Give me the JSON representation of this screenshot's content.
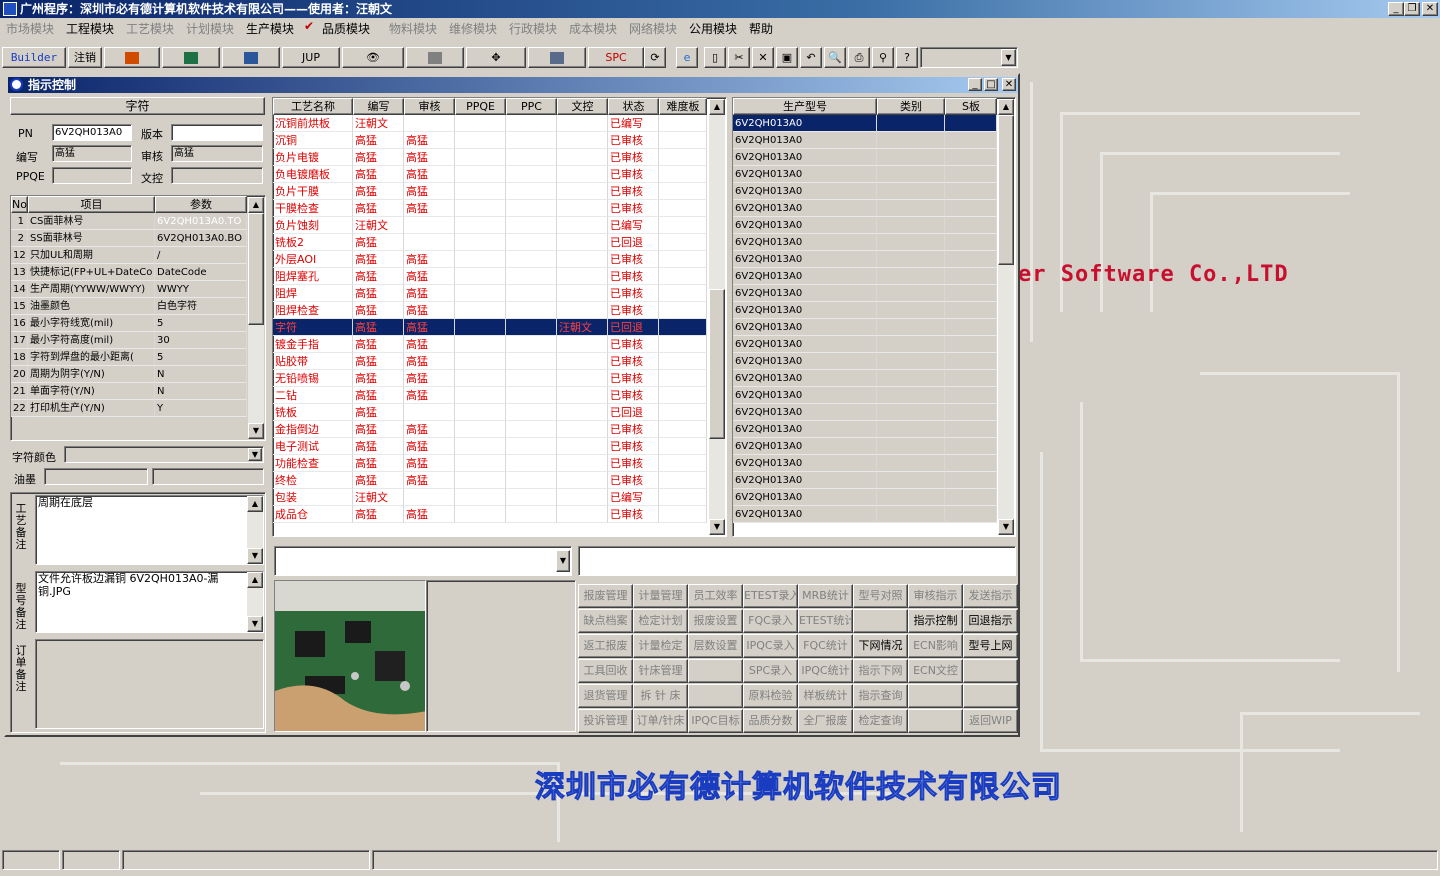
{
  "app_title": "广州程序：深圳市必有德计算机软件技术有限公司——使用者：汪朝文",
  "menu": [
    {
      "label": "市场模块",
      "active": false
    },
    {
      "label": "工程模块",
      "active": true
    },
    {
      "label": "工艺模块",
      "active": false
    },
    {
      "label": "计划模块",
      "active": false
    },
    {
      "label": "生产模块",
      "active": true
    },
    {
      "label": "品质模块",
      "active": true
    },
    {
      "label": "物料模块",
      "active": false
    },
    {
      "label": "维修模块",
      "active": false
    },
    {
      "label": "行政模块",
      "active": false
    },
    {
      "label": "成本模块",
      "active": false
    },
    {
      "label": "网络模块",
      "active": false
    },
    {
      "label": "公用模块",
      "active": true
    },
    {
      "label": "帮助",
      "active": true
    }
  ],
  "toolbar": {
    "builder": "Builder",
    "cancel": "注销",
    "jup": "JUP",
    "spc": "SPC"
  },
  "brand": {
    "english": "er Software Co.,LTD",
    "chinese": "深圳市必有德计算机软件技术有限公司"
  },
  "child_window": {
    "title": "指示控制"
  },
  "form": {
    "section_title": "字符",
    "pn_label": "PN",
    "pn_value": "6V2QH013A0",
    "version_label": "版本",
    "version_value": "",
    "writer_label": "编写",
    "writer_value": "高猛",
    "reviewer_label": "审核",
    "reviewer_value": "高猛",
    "ppqe_label": "PPQE",
    "ppqe_value": "",
    "doc_label": "文控",
    "doc_value": ""
  },
  "params": {
    "headers": [
      "No",
      "项目",
      "参数"
    ],
    "rows": [
      {
        "no": "1",
        "item": "CS面菲林号",
        "value": "6V2QH013A0.TO",
        "selected": true
      },
      {
        "no": "2",
        "item": "SS面菲林号",
        "value": "6V2QH013A0.BO",
        "selected": false
      },
      {
        "no": "12",
        "item": "只加UL和周期",
        "value": "/",
        "selected": false
      },
      {
        "no": "13",
        "item": "快捷标记(FP+UL+DateCo",
        "value": "DateCode",
        "selected": false
      },
      {
        "no": "14",
        "item": "生产周期(YYWW/WWYY)",
        "value": "WWYY",
        "selected": false
      },
      {
        "no": "15",
        "item": "油墨颜色",
        "value": "白色字符",
        "selected": false
      },
      {
        "no": "16",
        "item": "最小字符线宽(mil)",
        "value": "5",
        "selected": false
      },
      {
        "no": "17",
        "item": "最小字符高度(mil)",
        "value": "30",
        "selected": false
      },
      {
        "no": "18",
        "item": "字符到焊盘的最小距离(",
        "value": "5",
        "selected": false
      },
      {
        "no": "20",
        "item": "周期为阴字(Y/N)",
        "value": "N",
        "selected": false
      },
      {
        "no": "21",
        "item": "单面字符(Y/N)",
        "value": "N",
        "selected": false
      },
      {
        "no": "22",
        "item": "打印机生产(Y/N)",
        "value": "Y",
        "selected": false
      }
    ]
  },
  "char_color_label": "字符颜色",
  "ink_label": "油墨",
  "process_note_label": "工艺备注",
  "process_note": "周期在底层",
  "model_note_label": "型号备注",
  "model_note": "文件允许板边漏铜 6V2QH013A0-漏铜.JPG",
  "order_note_label": "订单备注",
  "process_grid": {
    "headers": [
      "工艺名称",
      "编写",
      "审核",
      "PPQE",
      "PPC",
      "文控",
      "状态",
      "难度板"
    ],
    "rows": [
      {
        "name": "沉铜前烘板",
        "writer": "汪朝文",
        "reviewer": "",
        "doc": "",
        "status": "已编写",
        "selected": false
      },
      {
        "name": "沉铜",
        "writer": "高猛",
        "reviewer": "高猛",
        "doc": "",
        "status": "已审核",
        "selected": false
      },
      {
        "name": "负片电镀",
        "writer": "高猛",
        "reviewer": "高猛",
        "doc": "",
        "status": "已审核",
        "selected": false
      },
      {
        "name": "负电镀磨板",
        "writer": "高猛",
        "reviewer": "高猛",
        "doc": "",
        "status": "已审核",
        "selected": false
      },
      {
        "name": "负片干膜",
        "writer": "高猛",
        "reviewer": "高猛",
        "doc": "",
        "status": "已审核",
        "selected": false
      },
      {
        "name": "干膜检查",
        "writer": "高猛",
        "reviewer": "高猛",
        "doc": "",
        "status": "已审核",
        "selected": false
      },
      {
        "name": "负片蚀刻",
        "writer": "汪朝文",
        "reviewer": "",
        "doc": "",
        "status": "已编写",
        "selected": false
      },
      {
        "name": "铣板2",
        "writer": "高猛",
        "reviewer": "",
        "doc": "",
        "status": "已回退",
        "selected": false
      },
      {
        "name": "外层AOI",
        "writer": "高猛",
        "reviewer": "高猛",
        "doc": "",
        "status": "已审核",
        "selected": false
      },
      {
        "name": "阻焊塞孔",
        "writer": "高猛",
        "reviewer": "高猛",
        "doc": "",
        "status": "已审核",
        "selected": false
      },
      {
        "name": "阻焊",
        "writer": "高猛",
        "reviewer": "高猛",
        "doc": "",
        "status": "已审核",
        "selected": false
      },
      {
        "name": "阻焊检查",
        "writer": "高猛",
        "reviewer": "高猛",
        "doc": "",
        "status": "已审核",
        "selected": false
      },
      {
        "name": "字符",
        "writer": "高猛",
        "reviewer": "高猛",
        "doc": "汪朝文",
        "status": "已回退",
        "selected": true
      },
      {
        "name": "镀金手指",
        "writer": "高猛",
        "reviewer": "高猛",
        "doc": "",
        "status": "已审核",
        "selected": false
      },
      {
        "name": "贴胶带",
        "writer": "高猛",
        "reviewer": "高猛",
        "doc": "",
        "status": "已审核",
        "selected": false
      },
      {
        "name": "无铅喷锡",
        "writer": "高猛",
        "reviewer": "高猛",
        "doc": "",
        "status": "已审核",
        "selected": false
      },
      {
        "name": "二钻",
        "writer": "高猛",
        "reviewer": "高猛",
        "doc": "",
        "status": "已审核",
        "selected": false
      },
      {
        "name": "铣板",
        "writer": "高猛",
        "reviewer": "",
        "doc": "",
        "status": "已回退",
        "selected": false
      },
      {
        "name": "金指倒边",
        "writer": "高猛",
        "reviewer": "高猛",
        "doc": "",
        "status": "已审核",
        "selected": false
      },
      {
        "name": "电子测试",
        "writer": "高猛",
        "reviewer": "高猛",
        "doc": "",
        "status": "已审核",
        "selected": false
      },
      {
        "name": "功能检查",
        "writer": "高猛",
        "reviewer": "高猛",
        "doc": "",
        "status": "已审核",
        "selected": false
      },
      {
        "name": "终检",
        "writer": "高猛",
        "reviewer": "高猛",
        "doc": "",
        "status": "已审核",
        "selected": false
      },
      {
        "name": "包装",
        "writer": "汪朝文",
        "reviewer": "",
        "doc": "",
        "status": "已编写",
        "selected": false
      },
      {
        "name": "成品仓",
        "writer": "高猛",
        "reviewer": "高猛",
        "doc": "",
        "status": "已审核",
        "selected": false
      }
    ]
  },
  "model_grid": {
    "headers": [
      "生产型号",
      "类别",
      "S板"
    ],
    "rows": [
      "6V2QH013A0",
      "6V2QH013A0",
      "6V2QH013A0",
      "6V2QH013A0",
      "6V2QH013A0",
      "6V2QH013A0",
      "6V2QH013A0",
      "6V2QH013A0",
      "6V2QH013A0",
      "6V2QH013A0",
      "6V2QH013A0",
      "6V2QH013A0",
      "6V2QH013A0",
      "6V2QH013A0",
      "6V2QH013A0",
      "6V2QH013A0",
      "6V2QH013A0",
      "6V2QH013A0",
      "6V2QH013A0",
      "6V2QH013A0",
      "6V2QH013A0",
      "6V2QH013A0",
      "6V2QH013A0",
      "6V2QH013A0"
    ]
  },
  "function_buttons": [
    [
      "报废管理",
      "计量管理",
      "员工效率",
      "ETEST录入",
      "MRB统计",
      "型号对照",
      "审核指示",
      "发送指示"
    ],
    [
      "缺点档案",
      "检定计划",
      "报废设置",
      "FQC录入",
      "ETEST统计",
      "",
      "指示控制",
      "回退指示"
    ],
    [
      "返工报废",
      "计量检定",
      "层数设置",
      "IPQC录入",
      "FQC统计",
      "下网情况",
      "ECN影响",
      "型号上网"
    ],
    [
      "工具回收",
      "针床管理",
      "",
      "SPC录入",
      "IPQC统计",
      "指示下网",
      "ECN文控",
      ""
    ],
    [
      "退货管理",
      "拆 针 床",
      "",
      "原料检验",
      "样板统计",
      "指示查询",
      "",
      ""
    ],
    [
      "投诉管理",
      "订单/针床",
      "IPQC目标",
      "品质分数",
      "全厂报废",
      "检定查询",
      "",
      "返回WIP"
    ]
  ],
  "function_buttons_active": [
    "指示控制",
    "回退指示",
    "下网情况",
    "型号上网"
  ]
}
